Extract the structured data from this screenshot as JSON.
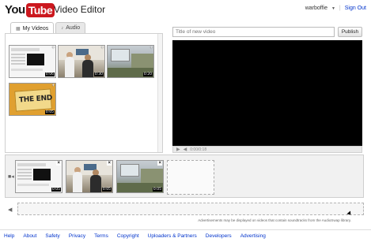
{
  "header": {
    "logo_you": "You",
    "logo_tube": "Tube",
    "title": "Video Editor",
    "username": "warboffie",
    "sign_out": "Sign Out"
  },
  "tabs": [
    {
      "label": "My Videos",
      "icon": "film-icon",
      "active": true
    },
    {
      "label": "Audio",
      "icon": "music-icon",
      "active": false
    }
  ],
  "library": [
    {
      "thumb": "screen",
      "duration": "0:06"
    },
    {
      "thumb": "people",
      "duration": "0:30"
    },
    {
      "thumb": "office",
      "duration": "0:20"
    },
    {
      "thumb": "end",
      "duration": "0:05",
      "text": "THE END"
    }
  ],
  "preview": {
    "title_placeholder": "Title of new video",
    "publish_label": "Publish",
    "time": "0:00/0:18"
  },
  "timeline": [
    {
      "thumb": "screen",
      "duration": "0:05"
    },
    {
      "thumb": "people",
      "duration": "0:05"
    },
    {
      "thumb": "office",
      "duration": "0:05"
    }
  ],
  "ad_note": "Advertisements may be displayed on videos that contain soundtracks from the AudioSwap library.",
  "footer": [
    "Help",
    "About",
    "Safety",
    "Privacy",
    "Terms",
    "Copyright",
    "Uploaders & Partners",
    "Developers",
    "Advertising"
  ]
}
